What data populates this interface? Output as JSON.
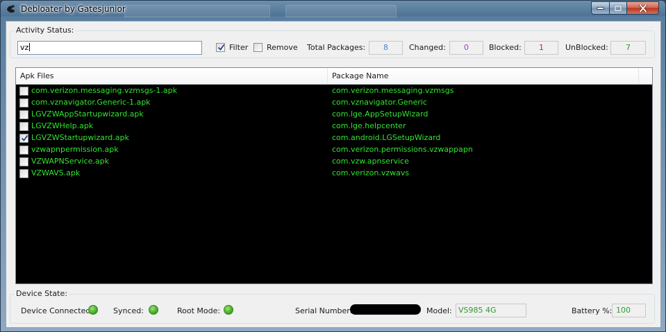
{
  "window": {
    "title": "Debloater by Gatesjunior",
    "icon": "debloater-app-icon"
  },
  "activity": {
    "group_label": "Activity Status:",
    "filter_text": "vz",
    "filter_label": "Filter",
    "filter_checked": true,
    "remove_label": "Remove",
    "remove_checked": false,
    "total_label": "Total Packages:",
    "total_value": "8",
    "changed_label": "Changed:",
    "changed_value": "0",
    "blocked_label": "Blocked:",
    "blocked_value": "1",
    "unblocked_label": "UnBlocked:",
    "unblocked_value": "7",
    "colors": {
      "total": "#4a7fd1",
      "changed": "#a03cc8",
      "blocked": "#d02020",
      "unblocked": "#2e9a2e"
    }
  },
  "packages": {
    "columns": [
      "Apk Files",
      "Package Name"
    ],
    "rows": [
      {
        "apk": "com.verizon.messaging.vzmsgs-1.apk",
        "package": "com.verizon.messaging.vzmsgs",
        "checked": false
      },
      {
        "apk": "com.vznavigator.Generic-1.apk",
        "package": "com.vznavigator.Generic",
        "checked": false
      },
      {
        "apk": "LGVZWAppStartupwizard.apk",
        "package": "com.lge.AppSetupWizard",
        "checked": false
      },
      {
        "apk": "LGVZWHelp.apk",
        "package": "com.lge.helpcenter",
        "checked": false
      },
      {
        "apk": "LGVZWStartupwizard.apk",
        "package": "com.android.LGSetupWizard",
        "checked": true
      },
      {
        "apk": "vzwapnpermission.apk",
        "package": "com.verizon.permissions.vzwappapn",
        "checked": false
      },
      {
        "apk": "VZWAPNService.apk",
        "package": "com.vzw.apnservice",
        "checked": false
      },
      {
        "apk": "VZWAVS.apk",
        "package": "com.verizon.vzwavs",
        "checked": false
      }
    ],
    "row_text_color": "#31e531"
  },
  "device": {
    "group_label": "Device State:",
    "connected_label": "Device Connected:",
    "synced_label": "Synced:",
    "root_label": "Root Mode:",
    "serial_label": "Serial Number:",
    "model_label": "Model:",
    "model_value": "VS985 4G",
    "battery_label": "Battery %:",
    "battery_value": "100",
    "status_color": "#4cae2b"
  }
}
